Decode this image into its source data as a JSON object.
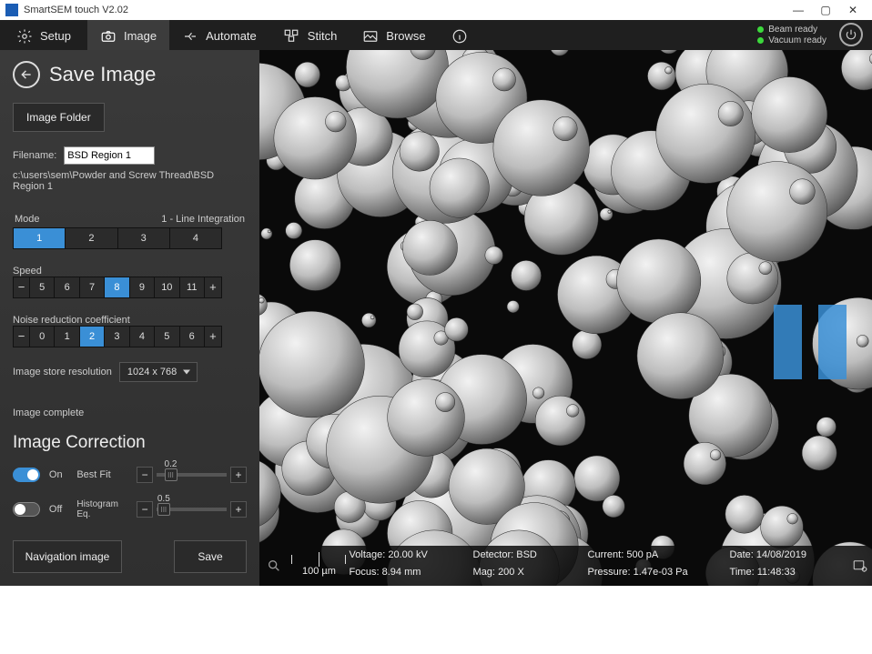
{
  "window": {
    "title": "SmartSEM touch V2.02"
  },
  "topbar": {
    "setup": "Setup",
    "image": "Image",
    "automate": "Automate",
    "stitch": "Stitch",
    "browse": "Browse"
  },
  "status": {
    "beam": "Beam ready",
    "vacuum": "Vacuum ready"
  },
  "side": {
    "title": "Save Image",
    "image_folder_btn": "Image Folder",
    "filename_label": "Filename:",
    "filename_value": "BSD Region 1",
    "path": "c:\\users\\sem\\Powder and Screw Thread\\BSD Region 1",
    "mode_label": "Mode",
    "mode_value_label": "1 - Line Integration",
    "mode_options": [
      "1",
      "2",
      "3",
      "4"
    ],
    "mode_selected": 0,
    "speed_label": "Speed",
    "speed_options": [
      "5",
      "6",
      "7",
      "8",
      "9",
      "10",
      "11"
    ],
    "speed_selected": 3,
    "noise_label": "Noise reduction coefficient",
    "noise_options": [
      "0",
      "1",
      "2",
      "3",
      "4",
      "5",
      "6"
    ],
    "noise_selected": 2,
    "res_label": "Image store resolution",
    "res_value": "1024 x 768",
    "image_complete": "Image complete",
    "correction_title": "Image Correction",
    "on_label": "On",
    "off_label": "Off",
    "bestfit_label": "Best Fit",
    "bestfit_value": "0.2",
    "histeq_label": "Histogram Eq.",
    "histeq_value": "0.5",
    "nav_btn": "Navigation image",
    "save_btn": "Save"
  },
  "footer": {
    "scale": "100 µm",
    "voltage_l": "Voltage:",
    "voltage_v": "20.00 kV",
    "detector_l": "Detector:",
    "detector_v": "BSD",
    "current_l": "Current:",
    "current_v": "500 pA",
    "date_l": "Date:",
    "date_v": "14/08/2019",
    "focus_l": "Focus:",
    "focus_v": "8.94 mm",
    "mag_l": "Mag:",
    "mag_v": "200 X",
    "pressure_l": "Pressure:",
    "pressure_v": "1.47e-03 Pa",
    "time_l": "Time:",
    "time_v": "11:48:33"
  }
}
